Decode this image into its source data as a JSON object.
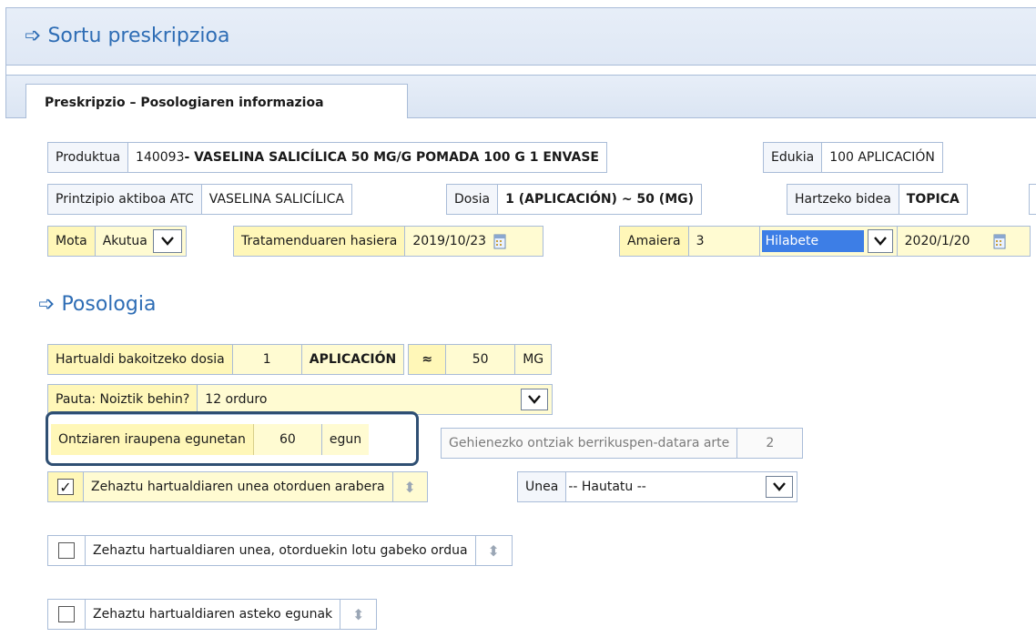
{
  "window": {
    "title": "Sortu preskripzioa"
  },
  "tabs": [
    {
      "label": "Preskripzio – Posologiaren informazioa"
    }
  ],
  "product": {
    "label": "Produktua",
    "code": "140093",
    "name": " - VASELINA SALICÍLICA 50 MG/G POMADA 100 G 1 ENVASE"
  },
  "content": {
    "label": "Edukia",
    "value": "100  APLICACIÓN"
  },
  "active_principle": {
    "label": "Printzipio aktiboa ATC",
    "value": "VASELINA SALICÍLICA"
  },
  "dose": {
    "label": "Dosia",
    "value": "1 (APLICACIÓN) ~ 50 (MG)"
  },
  "route": {
    "label": "Hartzeko bidea",
    "value": "TOPICA"
  },
  "type": {
    "label": "Mota",
    "value": "Akutua"
  },
  "treatment_start": {
    "label": "Tratamenduaren hasiera",
    "value": "2019/10/23"
  },
  "end": {
    "label": "Amaiera",
    "number": "3",
    "unit": "Hilabete",
    "date": "2020/1/20"
  },
  "posology": {
    "title": "Posologia",
    "dose_per_intake": {
      "label": "Hartualdi bakoitzeko dosia",
      "amount": "1",
      "unit": "APLICACIÓN",
      "approx": "≈",
      "mg_amount": "50",
      "mg_unit": "MG"
    },
    "pattern": {
      "label": "Pauta: Noiztik behin?",
      "value": "12 orduro"
    },
    "container_duration": {
      "label": "Ontziaren iraupena egunetan",
      "value": "60",
      "unit": "egun"
    },
    "max_containers": {
      "label": "Gehienezko ontziak berrikuspen-datara arte",
      "value": "2"
    },
    "by_meals": {
      "checked": true,
      "label": "Zehaztu hartualdiaren unea otorduen arabera",
      "moment_label": "Unea",
      "moment_value": "-- Hautatu --"
    },
    "unrelated_hour": {
      "checked": false,
      "label": "Zehaztu hartualdiaren unea, otorduekin lotu gabeko ordua"
    },
    "week_days": {
      "checked": false,
      "label": "Zehaztu hartualdiaren asteko egunak"
    }
  },
  "icons": {
    "arrow": "arrow-right-icon",
    "calendar": "calendar-icon",
    "dropdown": "chevron-down-icon",
    "sort": "sort-updown-icon"
  },
  "colors": {
    "accent": "#2e6db5",
    "highlight_yellow": "#fffbd2",
    "frame_border": "#a9bcd8"
  }
}
